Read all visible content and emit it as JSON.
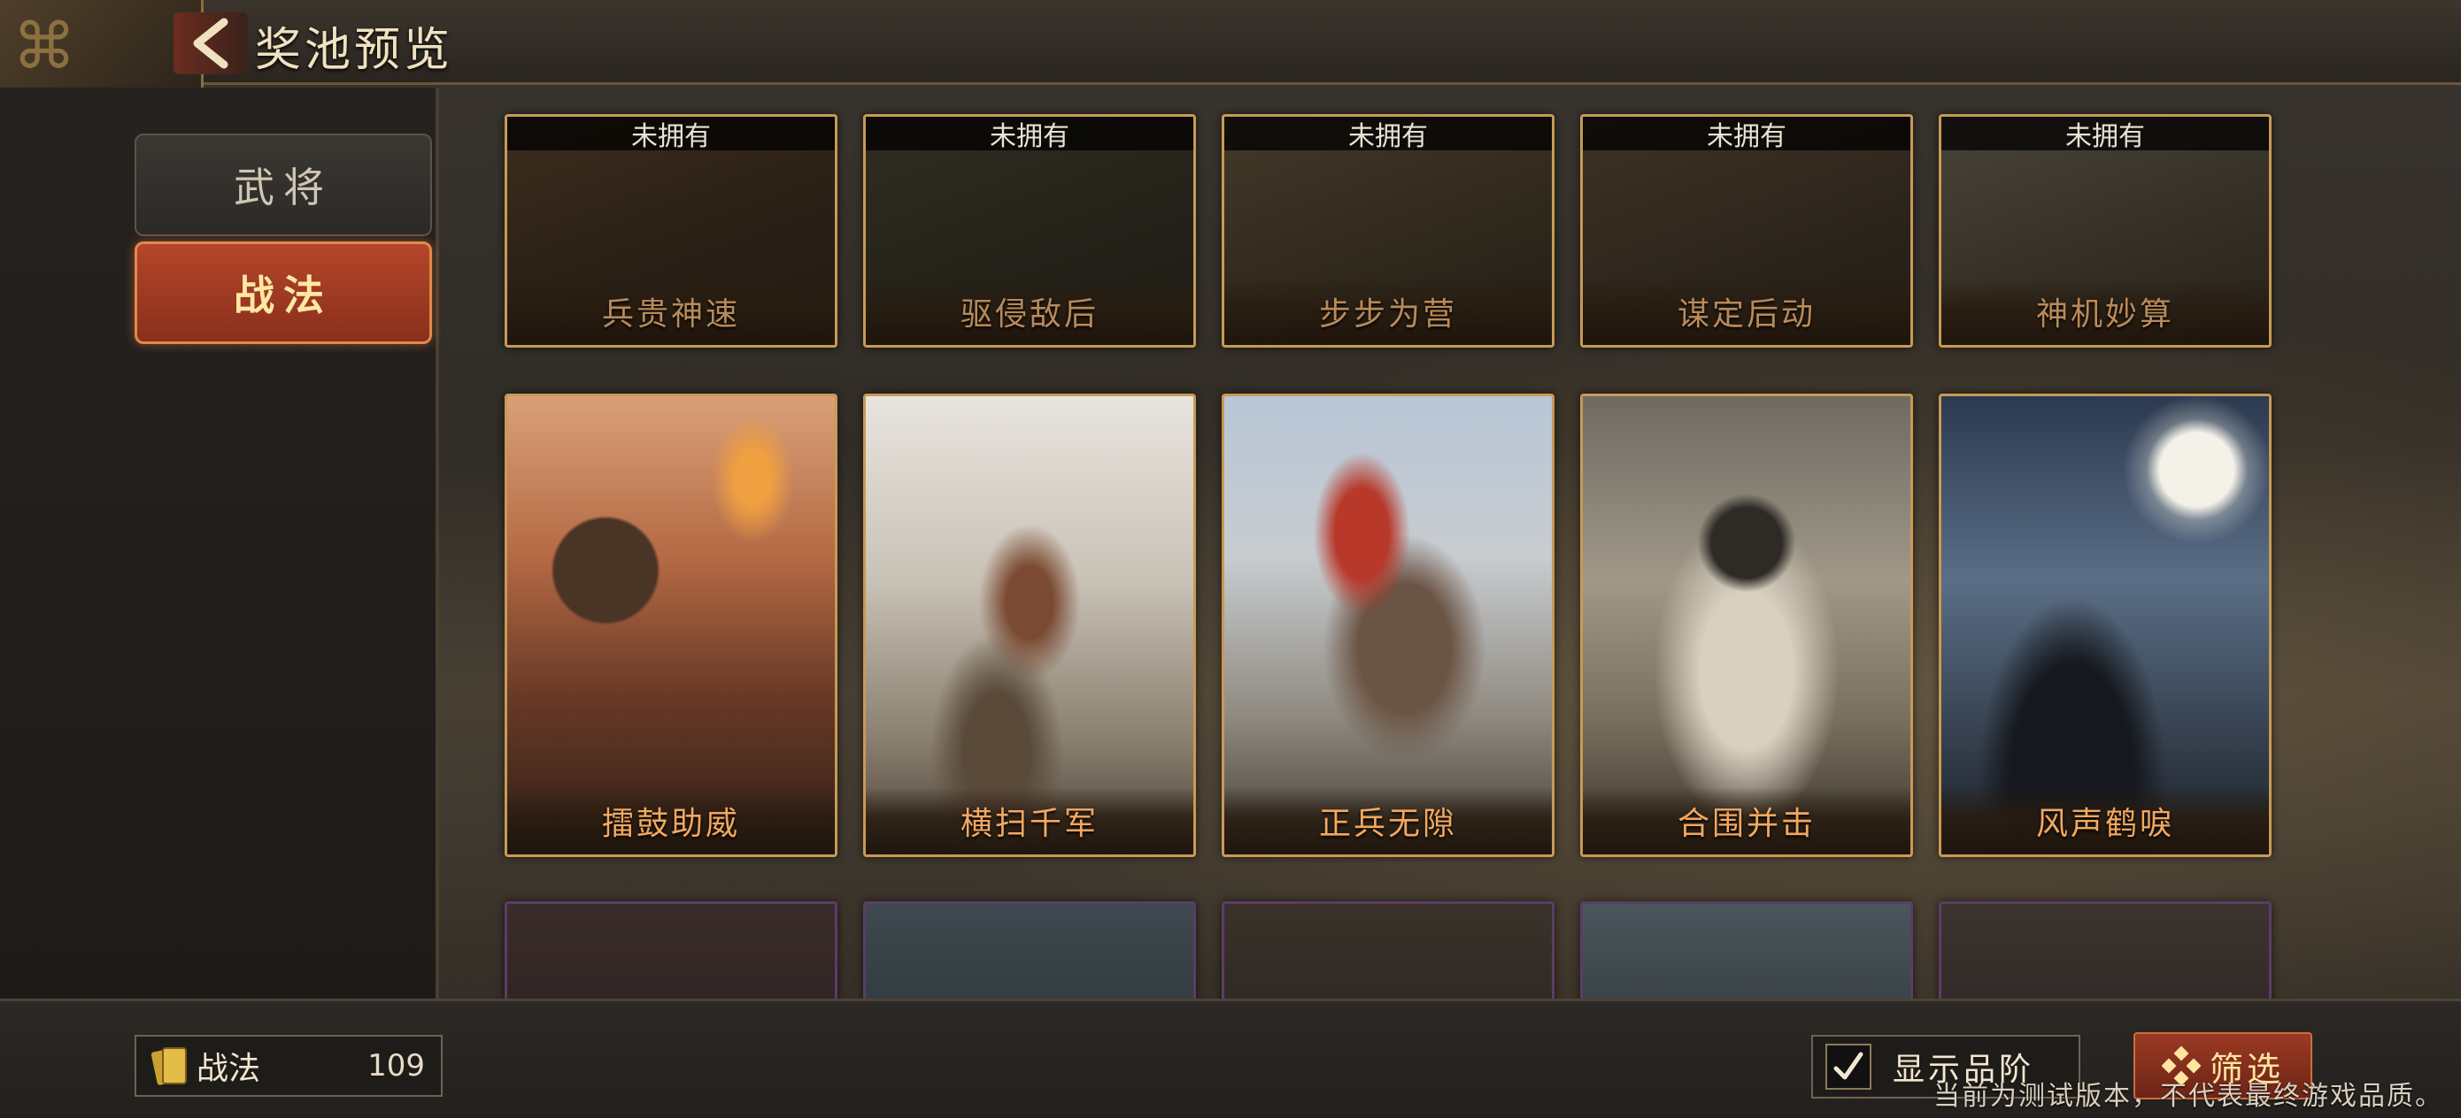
{
  "header": {
    "title": "奖池预览"
  },
  "sidebar": {
    "tabs": [
      {
        "label": "武将",
        "active": false
      },
      {
        "label": "战法",
        "active": true
      }
    ]
  },
  "row_top": [
    {
      "name": "兵贵神速",
      "status": "未拥有"
    },
    {
      "name": "驱侵敌后",
      "status": "未拥有"
    },
    {
      "name": "步步为营",
      "status": "未拥有"
    },
    {
      "name": "谋定后动",
      "status": "未拥有"
    },
    {
      "name": "神机妙算",
      "status": "未拥有"
    }
  ],
  "row_main": [
    {
      "name": "擂鼓助威"
    },
    {
      "name": "横扫千军"
    },
    {
      "name": "正兵无隙"
    },
    {
      "name": "合围并击"
    },
    {
      "name": "风声鹤唳"
    }
  ],
  "footer": {
    "count_label": "战法",
    "count_value": "109",
    "toggle_label": "显示品阶",
    "toggle_checked": true,
    "filter_label": "筛选",
    "notice": "当前为测试版本，不代表最终游戏品质。"
  },
  "colors": {
    "accent": "#c79a55",
    "active_tab": "#b4462a",
    "card_title": "#f3a860"
  }
}
